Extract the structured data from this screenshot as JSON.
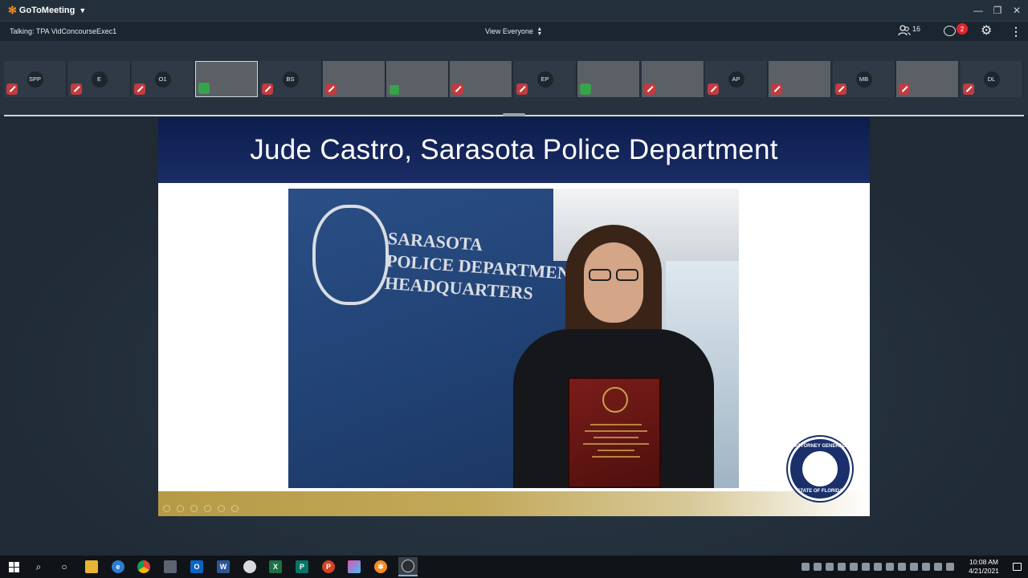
{
  "app": {
    "name": "GoToMeeting",
    "icons": [
      "gotomeeting-logo",
      "dropdown-caret-icon"
    ]
  },
  "window_controls": [
    "minimize-icon",
    "restore-icon",
    "close-icon"
  ],
  "meeting_bar": {
    "talking": "Talking: TPA VidConcourseExec1",
    "view": "View Everyone",
    "attendee_count": "16",
    "chat_badge": "2"
  },
  "participants": [
    {
      "initials": "SPP",
      "video": false,
      "audio": "muted"
    },
    {
      "initials": "E",
      "video": false,
      "audio": "muted"
    },
    {
      "initials": "O1",
      "video": false,
      "audio": "muted"
    },
    {
      "initials": "",
      "video": true,
      "audio": "speaking"
    },
    {
      "initials": "BS",
      "video": false,
      "audio": "muted"
    },
    {
      "initials": "",
      "video": true,
      "audio": "muted"
    },
    {
      "initials": "",
      "video": true,
      "audio": "phone"
    },
    {
      "initials": "",
      "video": true,
      "audio": "muted"
    },
    {
      "initials": "EP",
      "video": false,
      "audio": "muted"
    },
    {
      "initials": "",
      "video": true,
      "audio": "speaking"
    },
    {
      "initials": "",
      "video": true,
      "audio": "muted"
    },
    {
      "initials": "AP",
      "video": false,
      "audio": "muted"
    },
    {
      "initials": "",
      "video": true,
      "audio": "muted"
    },
    {
      "initials": "MB",
      "video": false,
      "audio": "muted"
    },
    {
      "initials": "",
      "video": true,
      "audio": "muted"
    },
    {
      "initials": "DL",
      "video": false,
      "audio": "muted"
    }
  ],
  "slide": {
    "title": "Jude Castro, Sarasota Police Department",
    "photo_sign": [
      "SARASOTA",
      "POLICE DEPARTMENT",
      "HEADQUARTERS"
    ],
    "seal_lines": [
      "ATTORNEY GENERAL",
      "STATE OF FLORIDA"
    ]
  },
  "taskbar": {
    "apps": [
      "windows-start-icon",
      "search-icon",
      "cortana-icon",
      "file-explorer-icon",
      "edge-icon",
      "chrome-icon",
      "calculator-icon",
      "outlook-icon",
      "word-icon",
      "paint-icon",
      "excel-icon",
      "publisher-icon",
      "powerpoint-icon",
      "photos-icon",
      "gotomeeting-icon",
      "screen-capture-icon"
    ],
    "time": "10:08 AM",
    "date": "4/21/2021"
  },
  "colors": {
    "slide_header": "#0c1d4d",
    "gold": "#b69a45",
    "muted": "#c23b3f",
    "speaking": "#37a34a",
    "badge": "#e0262d",
    "brand": "#f68b1f"
  }
}
